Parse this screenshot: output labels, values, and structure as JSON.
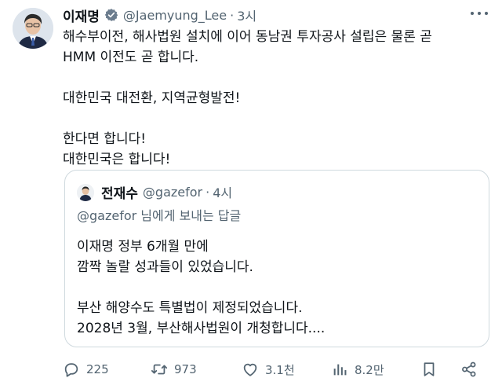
{
  "colors": {
    "text": "#0f1419",
    "muted": "#536471",
    "border": "#cfd9de",
    "verified_badge": "#6b7c8d",
    "accent": "#1d9bf0"
  },
  "tweet": {
    "author_name": "이재명",
    "handle": "@Jaemyung_Lee",
    "separator": "·",
    "time": "3시",
    "body_lines": [
      "해수부이전, 해사법원 설치에 이어 동남권 투자공사 설립은 물론 곧",
      "HMM 이전도 곧 합니다.",
      "",
      "대한민국 대전환, 지역균형발전!",
      "",
      "한다면 합니다!",
      "대한민국은 합니다!"
    ]
  },
  "quote": {
    "author_name": "전재수",
    "handle": "@gazefor",
    "separator": "·",
    "time": "4시",
    "reply_mention": "@gazefor",
    "reply_suffix": " 님에게 보내는 답글",
    "body_lines": [
      "이재명 정부 6개월 만에",
      "깜짝 놀랄 성과들이 있었습니다.",
      "",
      "부산 해양수도 특별법이 제정되었습니다.",
      "2028년 3월, 부산해사법원이 개청합니다...."
    ]
  },
  "actions": {
    "reply_count": "225",
    "retweet_count": "973",
    "like_count": "3.1천",
    "view_count": "8.2만"
  },
  "icons": [
    "verified-badge-icon",
    "more-icon",
    "reply-icon",
    "retweet-icon",
    "like-icon",
    "views-icon",
    "bookmark-icon",
    "share-icon"
  ]
}
